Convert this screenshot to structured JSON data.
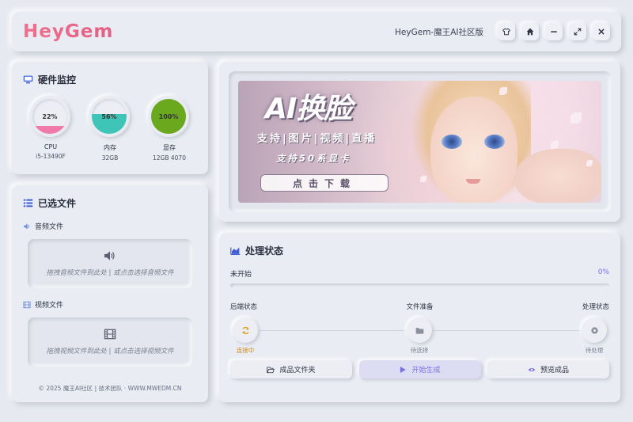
{
  "header": {
    "logo": "HeyGem",
    "app_title": "HeyGem-魔王AI社区版",
    "buttons": [
      {
        "icon": "shirt-icon"
      },
      {
        "icon": "home-icon"
      },
      {
        "icon": "minimize-icon"
      },
      {
        "icon": "maximize-icon"
      },
      {
        "icon": "close-icon"
      }
    ]
  },
  "hardware": {
    "title": "硬件监控",
    "gauges": [
      {
        "label": "CPU",
        "percent": "22%",
        "value": 22,
        "detail": "i5-13490F",
        "color": "#f07aa8"
      },
      {
        "label": "内存",
        "percent": "56%",
        "value": 56,
        "detail": "32GB",
        "color": "#3fc4b8"
      },
      {
        "label": "显存",
        "percent": "100%",
        "value": 100,
        "detail": "12GB 4070",
        "color": "#6aa81e"
      }
    ]
  },
  "files": {
    "title": "已选文件",
    "audio": {
      "label": "音频文件",
      "hint": "拖拽音频文件到此处 | 或点击选择音频文件"
    },
    "video": {
      "label": "视频文件",
      "hint": "拖拽视频文件到此处 | 或点击选择视频文件"
    },
    "footer": "© 2025 魔王AI社区 | 技术团队 · WWW.MWEDM.CN"
  },
  "banner": {
    "title": "AI换脸",
    "line1": "支持|图片|视频|直播",
    "line2": "支持50系显卡",
    "button": "点击下载"
  },
  "status": {
    "title": "处理状态",
    "state_text": "未开始",
    "progress_text": "0%",
    "progress": 0,
    "steps": [
      {
        "title": "后端状态",
        "state": "连接中",
        "icon": "sync-icon",
        "color": "#e0a020"
      },
      {
        "title": "文件准备",
        "state": "待选择",
        "icon": "folder-icon",
        "color": "#8a909e"
      },
      {
        "title": "处理状态",
        "state": "待处理",
        "icon": "gear-icon",
        "color": "#8a909e"
      }
    ],
    "actions": [
      {
        "label": "成品文件夹",
        "icon": "folder-open-icon"
      },
      {
        "label": "开始生成",
        "icon": "play-icon"
      },
      {
        "label": "预览成品",
        "icon": "eye-icon"
      }
    ]
  },
  "colors": {
    "accent": "#7a70e0",
    "background": "#e6e9f0",
    "logo": "#e86a84"
  }
}
